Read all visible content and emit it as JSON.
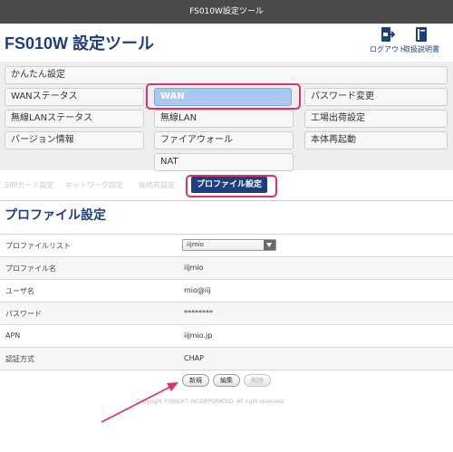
{
  "window": {
    "title": "FS010W設定ツール"
  },
  "header": {
    "app_title": "FS010W 設定ツール",
    "logout_label": "ログアウト",
    "manual_label": "取扱説明書"
  },
  "menu": {
    "kantan": "かんたん設定",
    "wan_status": "WANステータス",
    "wan": "WAN",
    "password_change": "パスワード変更",
    "wlan_status": "無線LANステータス",
    "wlan": "無線LAN",
    "factory_reset": "工場出荷設定",
    "version": "バージョン情報",
    "firewall": "ファイアウォール",
    "reboot": "本体再起動",
    "nat": "NAT"
  },
  "subtabs": {
    "sim": "SIMカード設定",
    "network": "ネットワーク設定",
    "connect_dest": "接続先設定",
    "profile": "プロファイル設定"
  },
  "section_title": "プロファイル設定",
  "profile_form": {
    "list_label": "プロファイルリスト",
    "list_selected": "iijmio",
    "name_label": "プロファイル名",
    "name_value": "iijmio",
    "user_label": "ユーザ名",
    "user_value": "mio@iij",
    "password_label": "パスワード",
    "password_value": "********",
    "apn_label": "APN",
    "apn_value": "iijmio.jp",
    "auth_label": "認証方式",
    "auth_value": "CHAP"
  },
  "actions": {
    "new": "新規",
    "edit": "編集",
    "delete": "削除"
  },
  "footer": {
    "copyright": "Copyright FUJISOFT INCORPORATED. All right reserved."
  },
  "colors": {
    "brand": "#1f3f7a",
    "highlight": "#e0306a",
    "selected_menu": "#a9c8f2"
  }
}
